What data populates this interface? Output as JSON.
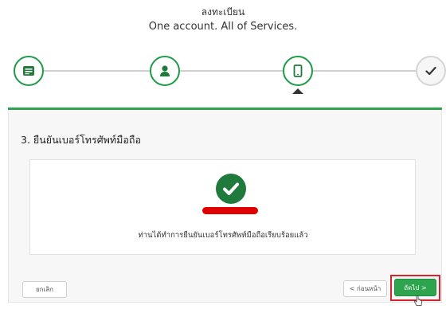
{
  "header": {
    "title": "ลงทะเบียน",
    "subtitle": "One account. All of Services."
  },
  "stepper": {
    "steps": [
      {
        "icon": "id-card-icon",
        "state": "done"
      },
      {
        "icon": "user-icon",
        "state": "done"
      },
      {
        "icon": "mobile-phone-icon",
        "state": "current"
      },
      {
        "icon": "checkmark-icon",
        "state": "pending"
      }
    ]
  },
  "section": {
    "title": "3. ยืนยันเบอร์โทรศัพท์มือถือ"
  },
  "card": {
    "status_icon": "success-check-icon",
    "message": "ท่านได้ทำการยืนยันเบอร์โทรศัพท์มือถือเรียบร้อยแล้ว"
  },
  "footer": {
    "cancel_label": "ยกเลิก",
    "back_label": "< ก่อนหน้า",
    "next_label": "ถัดไป >"
  },
  "colors": {
    "primary_green": "#2ea44f",
    "dark_green": "#1f7a3c",
    "highlight_red": "#d9232d"
  }
}
